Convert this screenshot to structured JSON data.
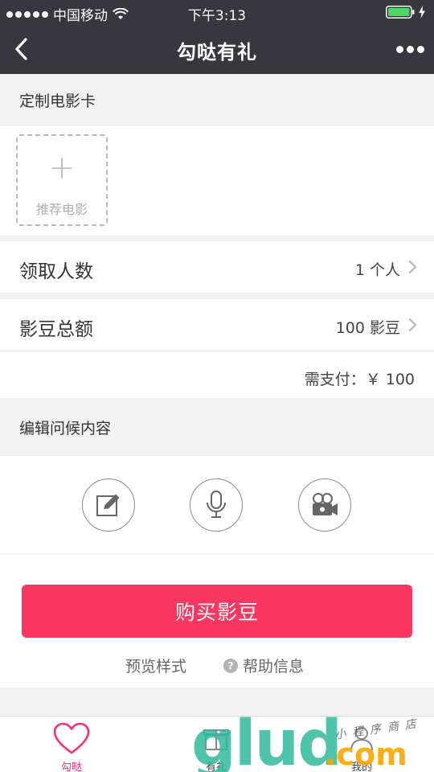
{
  "status_bar": {
    "carrier": "中国移动",
    "time": "下午3:13"
  },
  "nav": {
    "title": "勾哒有礼"
  },
  "custom_card": {
    "section_title": "定制电影卡",
    "slot_plus": "+",
    "slot_label": "推荐电影"
  },
  "recipients": {
    "label": "领取人数",
    "value": "1 个人"
  },
  "beans_total": {
    "label": "影豆总额",
    "value": "100 影豆"
  },
  "payment": {
    "text": "需支付：￥ 100"
  },
  "greeting": {
    "section_title": "编辑问候内容",
    "icons": [
      "edit-icon",
      "microphone-icon",
      "video-camera-icon"
    ]
  },
  "actions": {
    "buy_label": "购买影豆",
    "preview_label": "预览样式",
    "help_mark": "?",
    "help_label": "帮助信息"
  },
  "tab_bar": {
    "tabs": [
      {
        "label": "勾哒",
        "icon": "heart-icon",
        "active": true
      },
      {
        "label": "有礼",
        "icon": "gift-icon",
        "active": false
      },
      {
        "label": "我的",
        "icon": "user-icon",
        "active": false
      }
    ]
  },
  "watermark": {
    "main": "glud",
    "suffix": ".com",
    "tagline": "小程序商店"
  },
  "colors": {
    "nav_background": "#37373d",
    "accent": "#f8365f",
    "active_tab": "#ff2d6f",
    "page_background": "#f2f2f2"
  }
}
